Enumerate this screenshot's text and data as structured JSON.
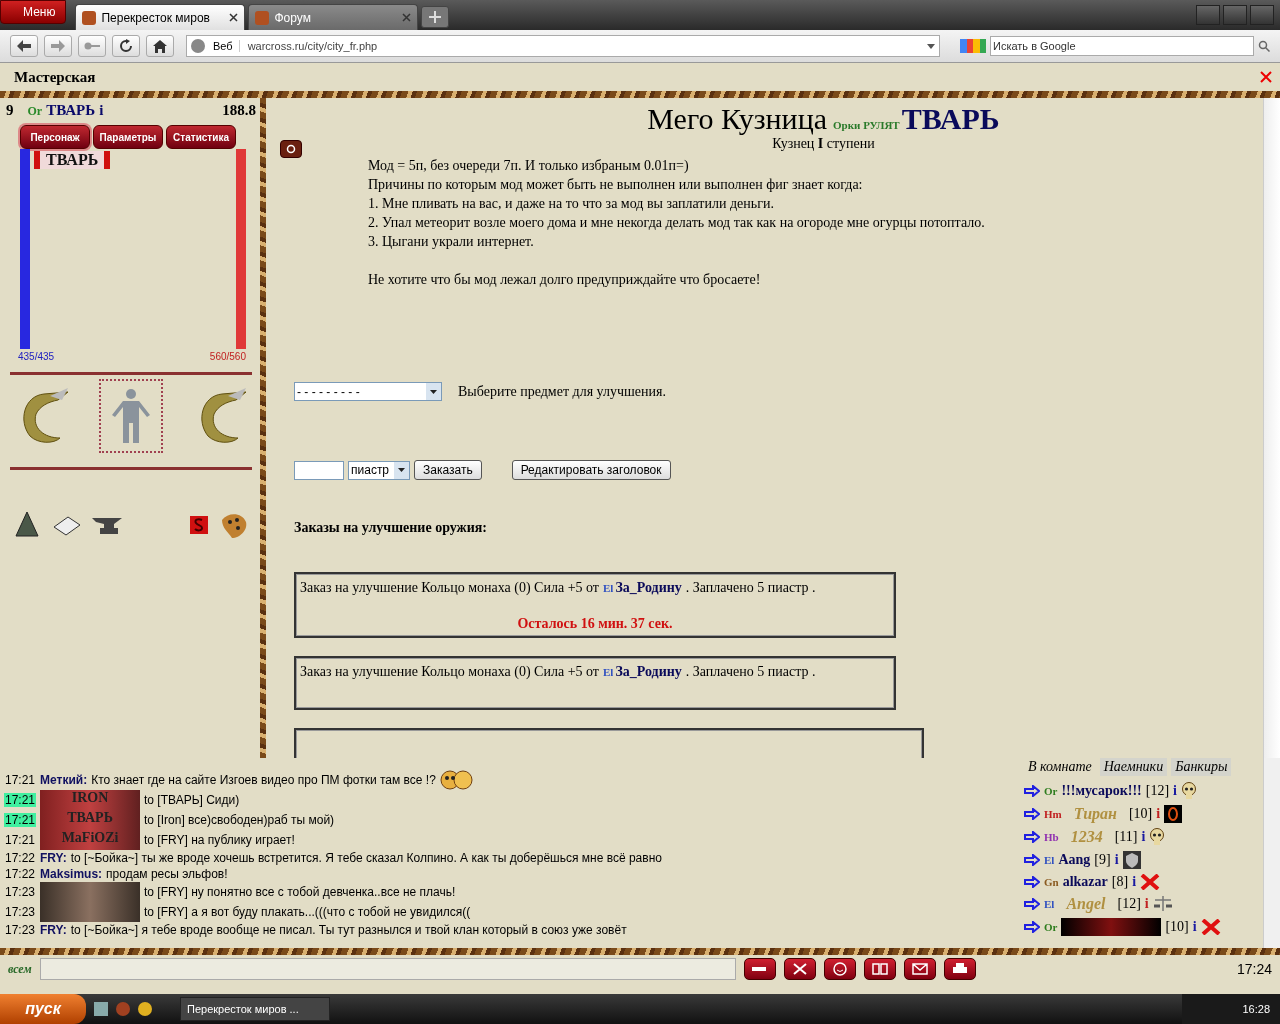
{
  "browser": {
    "menu": "Меню",
    "tabs": [
      {
        "title": "Перекресток миров",
        "selected": true
      },
      {
        "title": "Форум",
        "selected": false
      }
    ],
    "address": {
      "label": "Веб",
      "url": "warcross.ru/city/city_fr.php"
    },
    "search": {
      "placeholder": "Искать в Google"
    }
  },
  "page_title": "Мастерская",
  "character": {
    "level": "9",
    "race": "Or",
    "name": "ТВАРЬ",
    "info": "i",
    "money": "188.8",
    "tabs": [
      {
        "label": "Персонаж",
        "selected": true
      },
      {
        "label": "Параметры",
        "selected": false
      },
      {
        "label": "Статистика",
        "selected": false
      }
    ],
    "banner": "ТВАРЬ",
    "mana": {
      "level": 1,
      "reading": "435/435"
    },
    "health": {
      "level": 1,
      "reading": "560/560"
    }
  },
  "smithy": {
    "title": "Мего Кузница",
    "clan": "Орки РУЛЯТ",
    "owner": "ТВАРЬ",
    "subtitle": "Кузнец **I** ступени",
    "lines": [
      "Мод = 5п, без очереди 7п. И только избраным 0.01п=)",
      "Причины по которым мод может быть не выполнен или выполнен фиг знает когда:",
      "1. Мне пливать на вас, и даже на то что за мод вы заплатили деньги.",
      "2. Упал метеорит возле моего дома и мне некогда делать мод так как на огороде мне огурцы потоптало.",
      "3. Цыгани украли интернет."
    ],
    "note": "Не хотите что бы мод лежал долго предуприждайте что бросаете!",
    "item_select": {
      "value": "- - - - - - - - -",
      "label": "Выберите предмет для улучшения."
    },
    "currency": "пиастр",
    "order_button": "Заказать",
    "edit_button": "Редактировать заголовок",
    "orders_heading": "Заказы на улучшение оружия:",
    "orders": [
      {
        "text": "Заказ на улучшение Кольцо монаха (0) Сила +5 от",
        "race": "El",
        "customer": "За_Родину",
        "paid": ". Заплачено 5 пиастр .",
        "timer": "Осталось 16 мин. 37 сек."
      },
      {
        "text": "Заказ на улучшение Кольцо монаха (0) Сила +5 от",
        "race": "El",
        "customer": "За_Родину",
        "paid": ". Заплачено 5 пиастр ."
      }
    ]
  },
  "chat": {
    "messages": [
      {
        "time": "17:21",
        "highlighted": false,
        "kind": "text",
        "author": "Меткий:",
        "text": "Кто знает где на сайте Изгоев видео про ПМ фотки там все !?",
        "smiley": true
      },
      {
        "time": "17:21",
        "highlighted": true,
        "kind": "banner",
        "banner": "IRON",
        "text": "to [ТВАРЬ] Сиди)"
      },
      {
        "time": "17:21",
        "highlighted": true,
        "kind": "banner",
        "banner": "ТВАРЬ",
        "text": "to [Iron] все)свободен)раб ты мой)"
      },
      {
        "time": "17:21",
        "highlighted": false,
        "kind": "banner",
        "banner": "MaFiOZi",
        "text": "to [FRY] на публику играет!"
      },
      {
        "time": "17:22",
        "highlighted": false,
        "kind": "text",
        "author": "FRY:",
        "text": "to [~Бойка~] ты же вроде хочешь встретится. Я тебе сказал Колпино. А как ты доберёшься мне всё равно"
      },
      {
        "time": "17:22",
        "highlighted": false,
        "kind": "text",
        "author": "Maksimus:",
        "text": "продам ресы эльфов!"
      },
      {
        "time": "17:23",
        "highlighted": false,
        "kind": "photo",
        "text": "to [FRY] ну понятно все с тобой девченка..все не плачь!"
      },
      {
        "time": "17:23",
        "highlighted": false,
        "kind": "photo",
        "text": "to [FRY] а я вот буду плакать...(((что с тобой не увидился(("
      },
      {
        "time": "17:23",
        "highlighted": false,
        "kind": "text",
        "author": "FRY:",
        "text": "to [~Бойка~] я тебе вроде вообще не писал. Ты тут разнылся и твой клан который в союз уже зовёт"
      }
    ],
    "input_label": "всем",
    "time": "17:24"
  },
  "online": {
    "tabs": [
      {
        "label": "В комнате",
        "selected": true
      },
      {
        "label": "Наемники",
        "selected": false
      },
      {
        "label": "Банкиры",
        "selected": false
      }
    ],
    "users": [
      {
        "race": "Or",
        "color": "#2e7d1e",
        "kind": "text",
        "name": "!!!мусарок!!!",
        "level": "[12]",
        "info": {
          "text": "i",
          "color": "#1a1aa0"
        },
        "badge": {
          "kind": "skull"
        }
      },
      {
        "race": "Hm",
        "color": "#c02020",
        "kind": "banner",
        "name": "Тиран",
        "level": "[10]",
        "info": {
          "text": "i",
          "color": "#c02020"
        },
        "badge": {
          "kind": "ring"
        }
      },
      {
        "race": "Hb",
        "color": "#9030b0",
        "kind": "banner",
        "name": "1234",
        "level": "[11]",
        "info": {
          "text": "i",
          "color": "#1a1aa0"
        },
        "badge": {
          "kind": "skull"
        }
      },
      {
        "race": "El",
        "color": "#3050c0",
        "kind": "text",
        "name": "Aang",
        "level": "[9]",
        "info": {
          "text": "i",
          "color": "#1a1aa0"
        },
        "badge": {
          "kind": "shield"
        }
      },
      {
        "race": "Gn",
        "color": "#8a5a20",
        "kind": "text",
        "name": "alkazar",
        "level": "[8]",
        "info": {
          "text": "i",
          "color": "#1a1aa0"
        },
        "badge": {
          "kind": "cross"
        }
      },
      {
        "race": "El",
        "color": "#3050c0",
        "kind": "banner",
        "name": "Angel",
        "level": "[12]",
        "info": {
          "text": "i",
          "color": "#c02020"
        },
        "badge": {
          "kind": "scales"
        }
      },
      {
        "race": "Or",
        "color": "#2e7d1e",
        "kind": "dark",
        "level": "[10]",
        "info": {
          "text": "i",
          "color": "#1a1aa0"
        },
        "badge": {
          "kind": "cross"
        }
      }
    ]
  },
  "taskbar": {
    "start": "пуск",
    "task": "Перекресток миров ...",
    "clock": "16:28"
  }
}
